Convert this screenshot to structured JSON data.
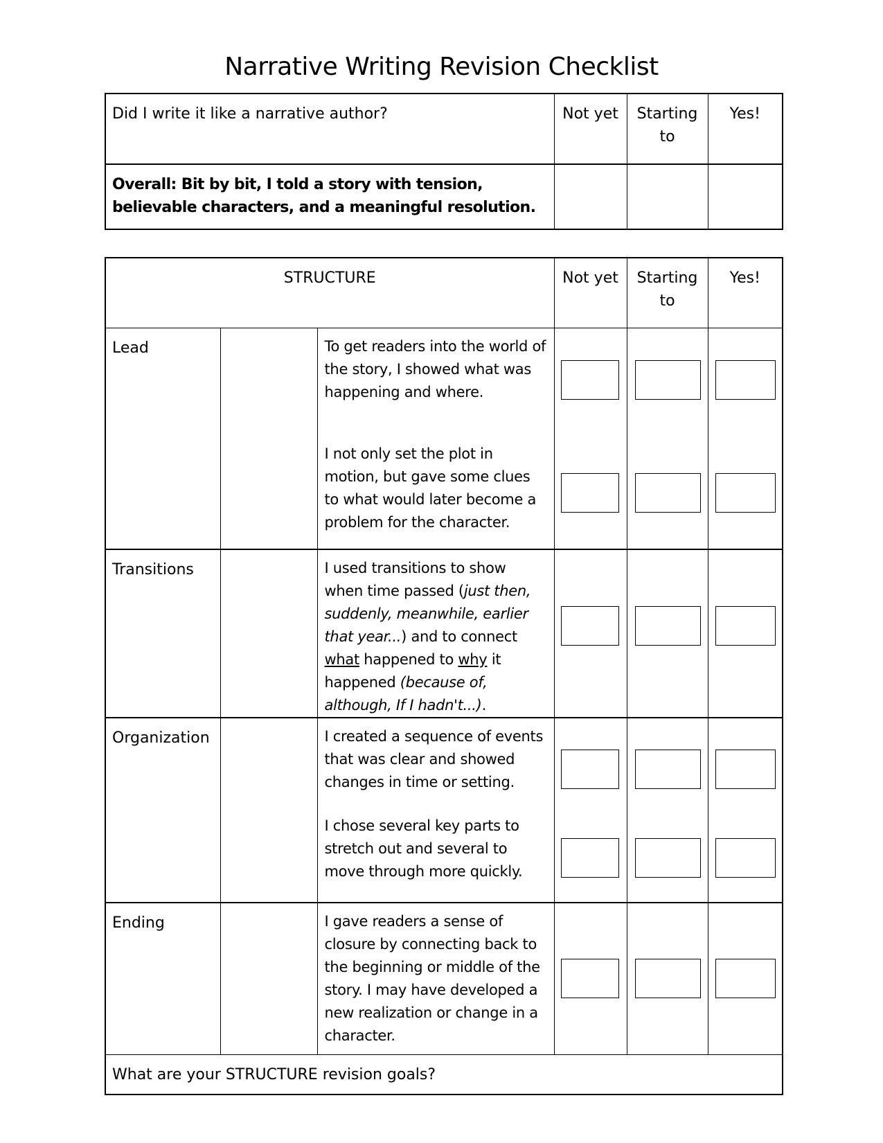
{
  "title": "Narrative Writing Revision Checklist",
  "overall_table": {
    "question": "Did I write it like a narrative author?",
    "columns": [
      "Not yet",
      "Starting to",
      "Yes!"
    ],
    "overall_statement": "Overall: Bit by bit, I told a story with tension, believable characters, and a meaningful resolution."
  },
  "structure_table": {
    "heading": "STRUCTURE",
    "columns": [
      "Not yet",
      "Starting to",
      "Yes!"
    ],
    "rows": [
      {
        "category": "Lead",
        "items": [
          {
            "text": "To get readers into the world of the story, I showed what was happening and where."
          },
          {
            "text": "I not only set the plot in motion, but gave some clues to what would later become a problem for the character."
          }
        ]
      },
      {
        "category": "Transitions",
        "items": [
          {
            "parts": [
              "I used transitions to show when time passed (",
              "just then, suddenly, meanwhile, earlier that year...",
              ") and to connect ",
              "what",
              " happened to ",
              "why",
              " it happened ",
              "(because of, although, If I hadn't...)",
              "."
            ]
          }
        ]
      },
      {
        "category": "Organization",
        "items": [
          {
            "text": "I created a sequence of events that was clear and showed changes in time or setting."
          },
          {
            "text": "I chose several key parts to stretch out and several to move through more quickly."
          }
        ]
      },
      {
        "category": "Ending",
        "items": [
          {
            "text": "I gave readers a sense of closure by connecting back to the beginning or middle of the story. I may have developed a new realization or change in a character."
          }
        ]
      }
    ],
    "goals_prompt": "What are your STRUCTURE revision goals?"
  }
}
